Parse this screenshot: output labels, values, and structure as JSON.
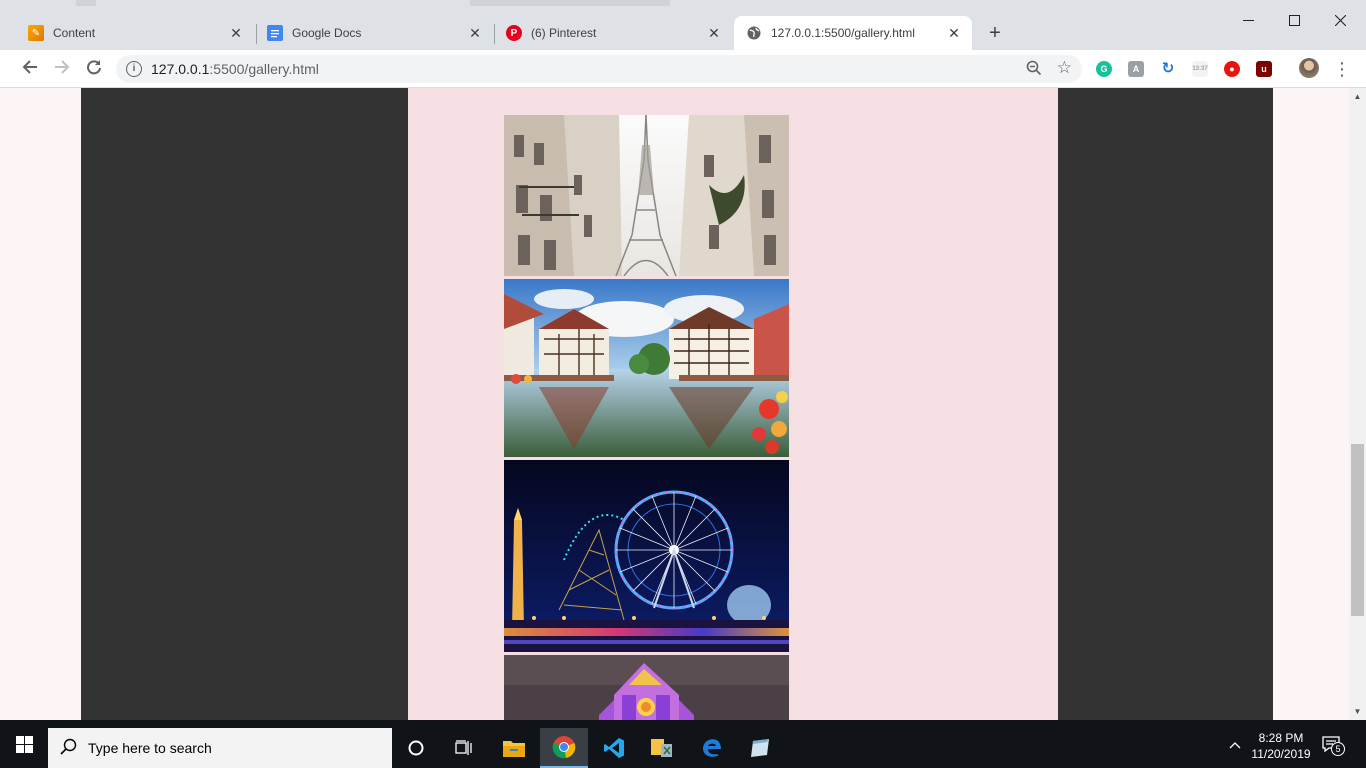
{
  "browser": {
    "tabs": [
      {
        "title": "Content",
        "icon": "content-icon",
        "color": "#f9ab00"
      },
      {
        "title": "Google Docs",
        "icon": "docs-icon",
        "color": "#4285f4"
      },
      {
        "title": "(6) Pinterest",
        "icon": "pinterest-icon",
        "color": "#e60023"
      },
      {
        "title": "127.0.0.1:5500/gallery.html",
        "icon": "globe-icon",
        "color": "#5f6368"
      }
    ],
    "address": {
      "host": "127.0.0.1",
      "rest": ":5500/gallery.html"
    }
  },
  "page": {
    "background": "#fdf4f5",
    "frame_color": "#333333",
    "content_color": "#f6dfe3",
    "gallery": [
      {
        "alt": "Eiffel Tower between Paris buildings"
      },
      {
        "alt": "Colorful half-timbered houses reflected in canal"
      },
      {
        "alt": "Ferris wheel lit at night with obelisk"
      },
      {
        "alt": "Illuminated cathedral facade"
      }
    ]
  },
  "taskbar": {
    "search_placeholder": "Type here to search",
    "time": "8:28 PM",
    "date": "11/20/2019",
    "notification_count": "5"
  }
}
